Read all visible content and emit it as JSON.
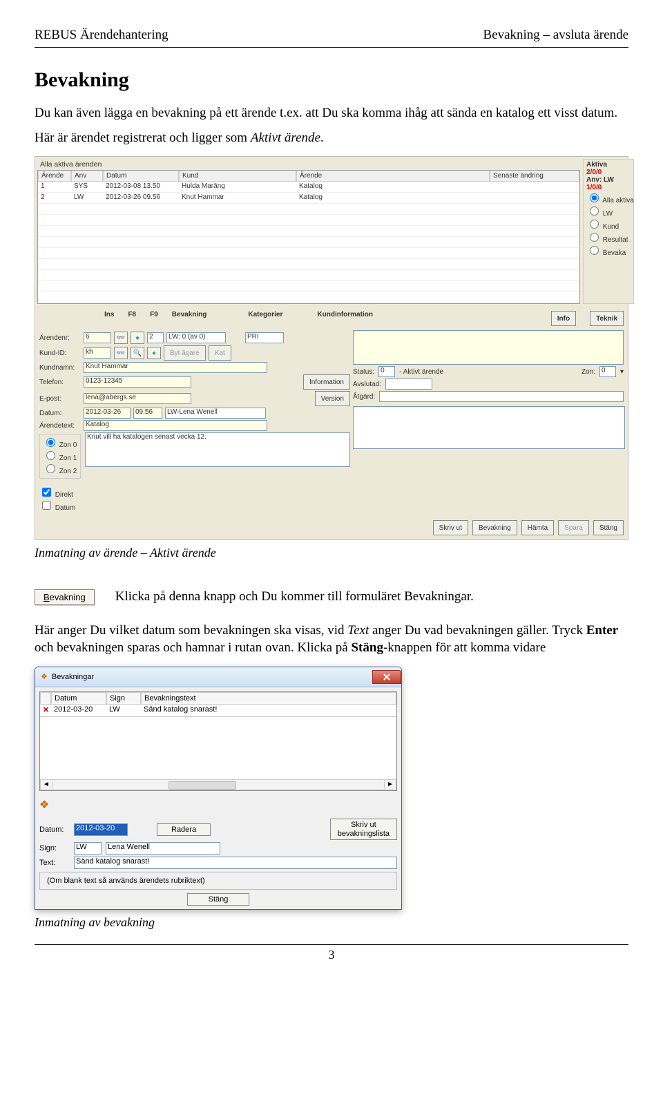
{
  "header": {
    "left": "REBUS Ärendehantering",
    "right": "Bevakning – avsluta ärende"
  },
  "h1": "Bevakning",
  "intro": {
    "p1a": "Du kan även lägga en bevakning på ett ärende t.ex. att Du ska komma ihåg att sända en katalog ett visst datum.",
    "p2a": "Här är ärendet registrerat och ligger som ",
    "p2b": "Aktivt ärende",
    "p2c": "."
  },
  "screenshot1": {
    "fieldset_title": "Alla aktiva ärenden",
    "side": {
      "aktiva": "Aktiva",
      "count1": "2/0/0",
      "anv": "Anv: LW",
      "count2": "1/0/0",
      "r_all": "Alla aktiva",
      "r_lw": "LW",
      "r_kund": "Kund",
      "r_res": "Resultat",
      "r_bev": "Bevaka"
    },
    "grid": {
      "headers": [
        "Ärende",
        "Anv",
        "Datum",
        "Kund",
        "Ärende",
        "Senaste ändring"
      ],
      "rows": [
        [
          "1",
          "SYS",
          "2012-03-08 13.50",
          "Hulda Maräng",
          "Katalog",
          ""
        ],
        [
          "2",
          "LW",
          "2012-03-26 09.56",
          "Knut Hammar",
          "Katalog",
          ""
        ]
      ]
    },
    "form": {
      "header_labels": {
        "ins": "Ins",
        "f8": "F8",
        "f9": "F9",
        "bev": "Bevakning",
        "kat": "Kategorier",
        "kinfo": "Kundinformation",
        "info": "Info",
        "teknik": "Teknik"
      },
      "arendenr_lbl": "Ärendenr:",
      "arendenr_val": "6",
      "bev_1": "2",
      "bev_2": "LW: 0  (av 0)",
      "kat_val": "PRI",
      "kundid_lbl": "Kund-ID:",
      "kundid_val": "kh",
      "bytagare": "Byt ägare",
      "kat_btn": "Kat",
      "kundnamn_lbl": "Kundnamn:",
      "kundnamn_val": "Knut Hammar",
      "telefon_lbl": "Telefon:",
      "telefon_val": "0123-12345",
      "info_btn": "Information",
      "epost_lbl": "E-post:",
      "epost_val": "lena@abergs.se",
      "version_btn": "Version",
      "status_lbl": "Status:",
      "status_code": "0",
      "status_text": "- Aktivt ärende",
      "zon_lbl": "Zon:",
      "zon_val": "0",
      "datum_lbl": "Datum:",
      "datum_val": "2012-03-26",
      "tid_val": "09.56",
      "owner": "LW-Lena Wenell",
      "avslutad_lbl": "Avslutad:",
      "arendetext_lbl": "Ärendetext:",
      "arendetext_val": "Katalog",
      "atgard_lbl": "Åtgärd:",
      "desc": "Knut vill ha katalogen senast vecka 12.",
      "zon_group": {
        "z0": "Zon 0",
        "z1": "Zon 1",
        "z2": "Zon 2"
      },
      "chk_direkt": "Direkt",
      "chk_datum": "Datum",
      "btns": {
        "skrivut": "Skriv ut",
        "bevakning": "Bevakning",
        "hamta": "Hämta",
        "spara": "Spara",
        "stang": "Stäng"
      }
    }
  },
  "caption1": "Inmatning av ärende – Aktivt ärende",
  "bevakning": {
    "button": "Bevakning",
    "text": "Klicka på denna knapp och Du kommer till formuläret Bevakningar."
  },
  "para3": {
    "a": "Här anger Du vilket datum som bevakningen ska visas, vid ",
    "b": "Text",
    "c": " anger Du vad bevakningen gäller. Tryck ",
    "d": "Enter",
    "e": " och bevakningen sparas och hamnar i rutan ovan. Klicka på ",
    "f": "Stäng",
    "g": "-knappen för att komma vidare"
  },
  "dialog": {
    "title": "Bevakningar",
    "grid": {
      "headers": [
        "",
        "Datum",
        "Sign",
        "Bevakningstext"
      ],
      "row": [
        "✕",
        "2012-03-20",
        "LW",
        "Sänd katalog snarast!"
      ]
    },
    "form": {
      "datum_lbl": "Datum:",
      "datum_val": "2012-03-20",
      "radera": "Radera",
      "skrivut_line1": "Skriv ut",
      "skrivut_line2": "bevakningslista",
      "sign_lbl": "Sign:",
      "sign_val": "LW",
      "sign_name": "Lena Wenell",
      "text_lbl": "Text:",
      "text_val": "Sänd katalog snarast!",
      "note": "(Om blank text så används ärendets rubriktext)",
      "stang": "Stäng"
    }
  },
  "caption2": "Inmatning av bevakning",
  "page_num": "3"
}
